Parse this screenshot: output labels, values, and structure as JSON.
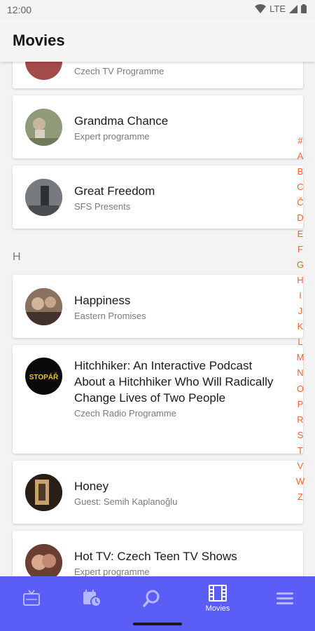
{
  "status_bar": {
    "time": "12:00",
    "network": "LTE"
  },
  "app_bar": {
    "title": "Movies"
  },
  "list": {
    "top_partial": {
      "subtitle": "Czech TV Programme"
    },
    "items_g": [
      {
        "title": "Grandma Chance",
        "subtitle": "Expert programme",
        "avatar_color": "#8f9a78"
      },
      {
        "title": "Great Freedom",
        "subtitle": "SFS Presents",
        "avatar_color": "#5d6168"
      }
    ],
    "section_h": "H",
    "items_h": [
      {
        "title": "Happiness",
        "subtitle": "Eastern Promises",
        "avatar_color": "#6e5a4e"
      },
      {
        "title": "Hitchhiker: An Interactive Podcast About a Hitchhiker Who Will Radically Change Lives of Two People",
        "subtitle": "Czech Radio Programme",
        "avatar_color": "#0a0a0a",
        "avatar_text": "STOPÁŘ"
      },
      {
        "title": "Honey",
        "subtitle": "Guest: Semih Kaplanoğlu",
        "avatar_color": "#3b2c20"
      },
      {
        "title": "Hot TV: Czech Teen TV Shows",
        "subtitle": "Expert programme",
        "avatar_color": "#7c4e3c"
      }
    ]
  },
  "alpha_index": [
    "#",
    "A",
    "B",
    "C",
    "Č",
    "D",
    "E",
    "F",
    "G",
    "H",
    "I",
    "J",
    "K",
    "L",
    "M",
    "N",
    "O",
    "P",
    "R",
    "S",
    "T",
    "V",
    "W",
    "Z"
  ],
  "bottom_nav": {
    "items": [
      {
        "icon": "tv-icon",
        "label": ""
      },
      {
        "icon": "calendar-clock-icon",
        "label": ""
      },
      {
        "icon": "search-icon",
        "label": ""
      },
      {
        "icon": "film-icon",
        "label": "Movies"
      },
      {
        "icon": "menu-icon",
        "label": ""
      }
    ]
  },
  "colors": {
    "accent": "#f4622e",
    "nav_bg": "#5a5ef7",
    "nav_inactive": "#b5b8ff"
  }
}
